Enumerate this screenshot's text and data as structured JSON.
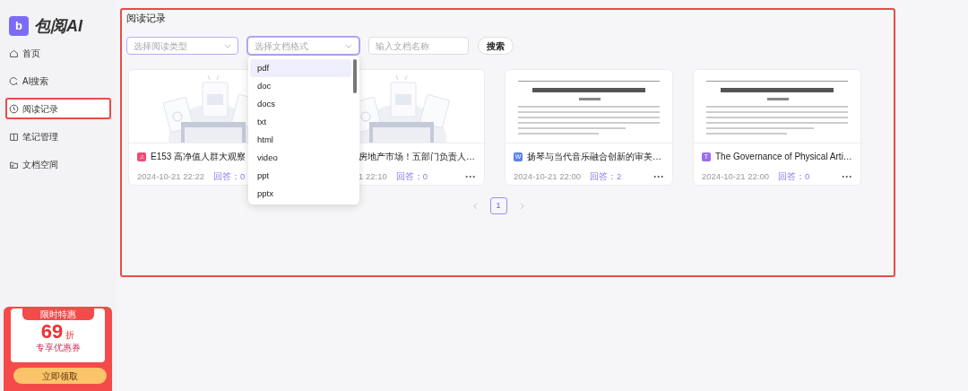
{
  "logo": {
    "badge": "b",
    "name": "包阅AI"
  },
  "nav": [
    {
      "label": "首页",
      "selected": false
    },
    {
      "label": "AI搜索",
      "selected": false
    },
    {
      "label": "阅读记录",
      "selected": true
    },
    {
      "label": "笔记管理",
      "selected": false
    },
    {
      "label": "文档空间",
      "selected": false
    }
  ],
  "promo": {
    "ribbon": "限时特惠",
    "value": "69",
    "unit": "折",
    "caption": "专享优惠券",
    "button": "立即领取"
  },
  "page_title": "阅读记录",
  "filters": {
    "reading_type": {
      "placeholder": "选择阅读类型",
      "expanded": false
    },
    "doc_format": {
      "placeholder": "选择文档格式",
      "expanded": true
    },
    "name": {
      "placeholder": "输入文档名称"
    },
    "search_button": "搜索"
  },
  "format_options": [
    {
      "label": "pdf",
      "selected": true
    },
    {
      "label": "doc",
      "selected": false
    },
    {
      "label": "docs",
      "selected": false
    },
    {
      "label": "txt",
      "selected": false
    },
    {
      "label": "html",
      "selected": false
    },
    {
      "label": "video",
      "selected": false
    },
    {
      "label": "ppt",
      "selected": false
    },
    {
      "label": "pptx",
      "selected": false
    }
  ],
  "cards": [
    {
      "kind": "illustration",
      "type_badge": "♫",
      "color": "#f24a78",
      "title": "E153 高净值人群大观察",
      "date": "2024-10-21 22:22",
      "answers": "回答：0",
      "covered": false
    },
    {
      "kind": "illustration",
      "title": "房地产市场！五部门负责人…",
      "date": "1 22:10",
      "answers": "回答：0",
      "covered": true,
      "menu": "···"
    },
    {
      "kind": "picture",
      "type_badge": "W",
      "color": "#5b7ff5",
      "title": "扬琴与当代音乐融合创新的审美…",
      "date": "2024-10-21 22:00",
      "answers": "回答：2",
      "covered": false,
      "menu": "···"
    },
    {
      "kind": "picture",
      "type_badge": "T",
      "color": "#9a6cf0",
      "title": "The Governance of Physical Arti…",
      "date": "2024-10-21 22:00",
      "answers": "回答：0",
      "covered": false,
      "menu": "···"
    }
  ],
  "pagination": {
    "pages": [
      {
        "label": "1",
        "selected": true
      }
    ]
  }
}
